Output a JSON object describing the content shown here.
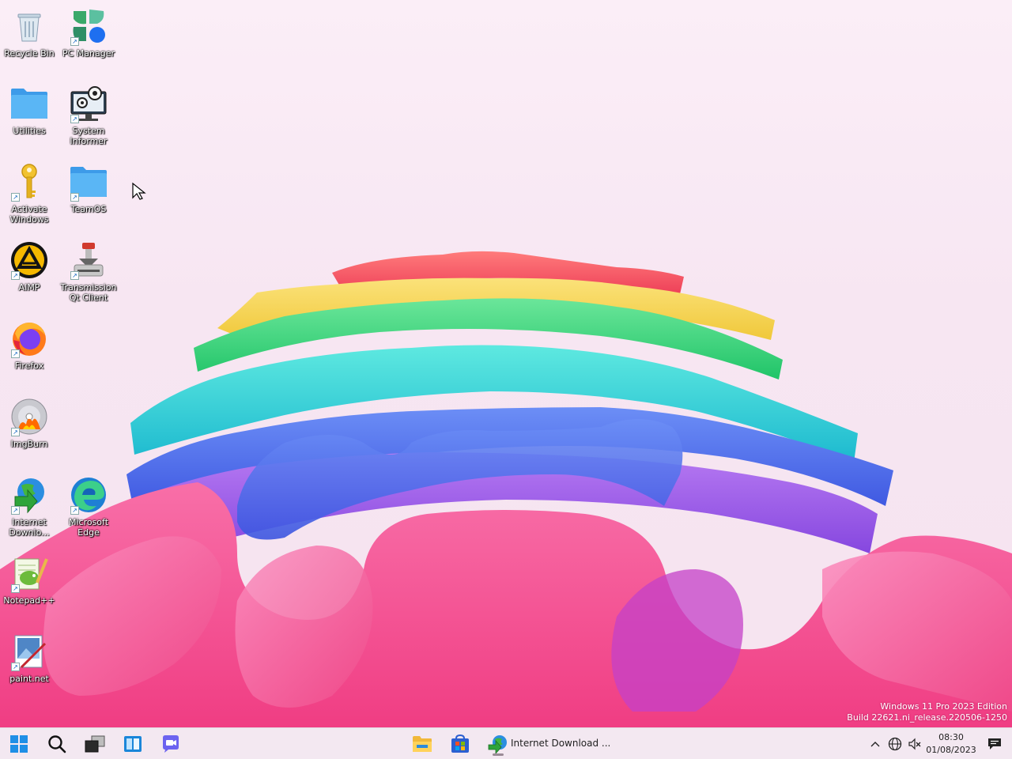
{
  "desktop": {
    "icons": [
      {
        "label": "Recycle Bin",
        "icon": "recycle-bin-icon"
      },
      {
        "label": "PC Manager",
        "icon": "pc-manager-icon"
      },
      {
        "label": "Utilities",
        "icon": "folder-icon"
      },
      {
        "label": "System Informer",
        "icon": "system-informer-icon"
      },
      {
        "label": "Activate Windows",
        "icon": "key-icon"
      },
      {
        "label": "TeamOS",
        "icon": "folder-icon"
      },
      {
        "label": "AIMP",
        "icon": "aimp-icon"
      },
      {
        "label": "Transmission Qt Client",
        "icon": "transmission-icon"
      },
      {
        "label": "Firefox",
        "icon": "firefox-icon"
      },
      {
        "label": "ImgBurn",
        "icon": "imgburn-icon"
      },
      {
        "label": "Internet Downlo...",
        "icon": "internet-download-manager-icon"
      },
      {
        "label": "Microsoft Edge",
        "icon": "edge-icon"
      },
      {
        "label": "Notepad++",
        "icon": "notepadpp-icon"
      },
      {
        "label": "paint.net",
        "icon": "paintnet-icon"
      }
    ]
  },
  "watermark": {
    "line1": "Windows 11 Pro 2023 Edition",
    "line2": "Build 22621.ni_release.220506-1250"
  },
  "taskbar": {
    "pinned": [
      {
        "name": "start-button",
        "icon": "windows-logo-icon"
      },
      {
        "name": "search-button",
        "icon": "search-icon"
      },
      {
        "name": "task-view-button",
        "icon": "task-view-icon"
      },
      {
        "name": "widgets-button",
        "icon": "widgets-icon"
      },
      {
        "name": "chat-button",
        "icon": "chat-icon"
      }
    ],
    "apps": [
      {
        "name": "file-explorer",
        "icon": "file-explorer-icon"
      },
      {
        "name": "microsoft-store",
        "icon": "store-icon"
      },
      {
        "name": "internet-download-manager",
        "icon": "internet-download-manager-icon",
        "label": "Internet Download ..."
      }
    ],
    "tray": {
      "chevron": "chevron-up-icon",
      "network": "globe-icon",
      "volume": "volume-muted-icon",
      "time": "08:30",
      "date": "01/08/2023",
      "notifications": "notification-icon"
    }
  },
  "colors": {
    "background": "#f7e6f2",
    "taskbar": "#f3e8f0",
    "folder": "#4aa8f0",
    "bloom_pink": "#f45f9c",
    "bloom_purple": "#9a56e6",
    "bloom_blue": "#4c6ff0",
    "bloom_cyan": "#23cfd2",
    "bloom_green": "#2ed37a",
    "bloom_yellow": "#f3d346",
    "bloom_red": "#f2555f"
  }
}
